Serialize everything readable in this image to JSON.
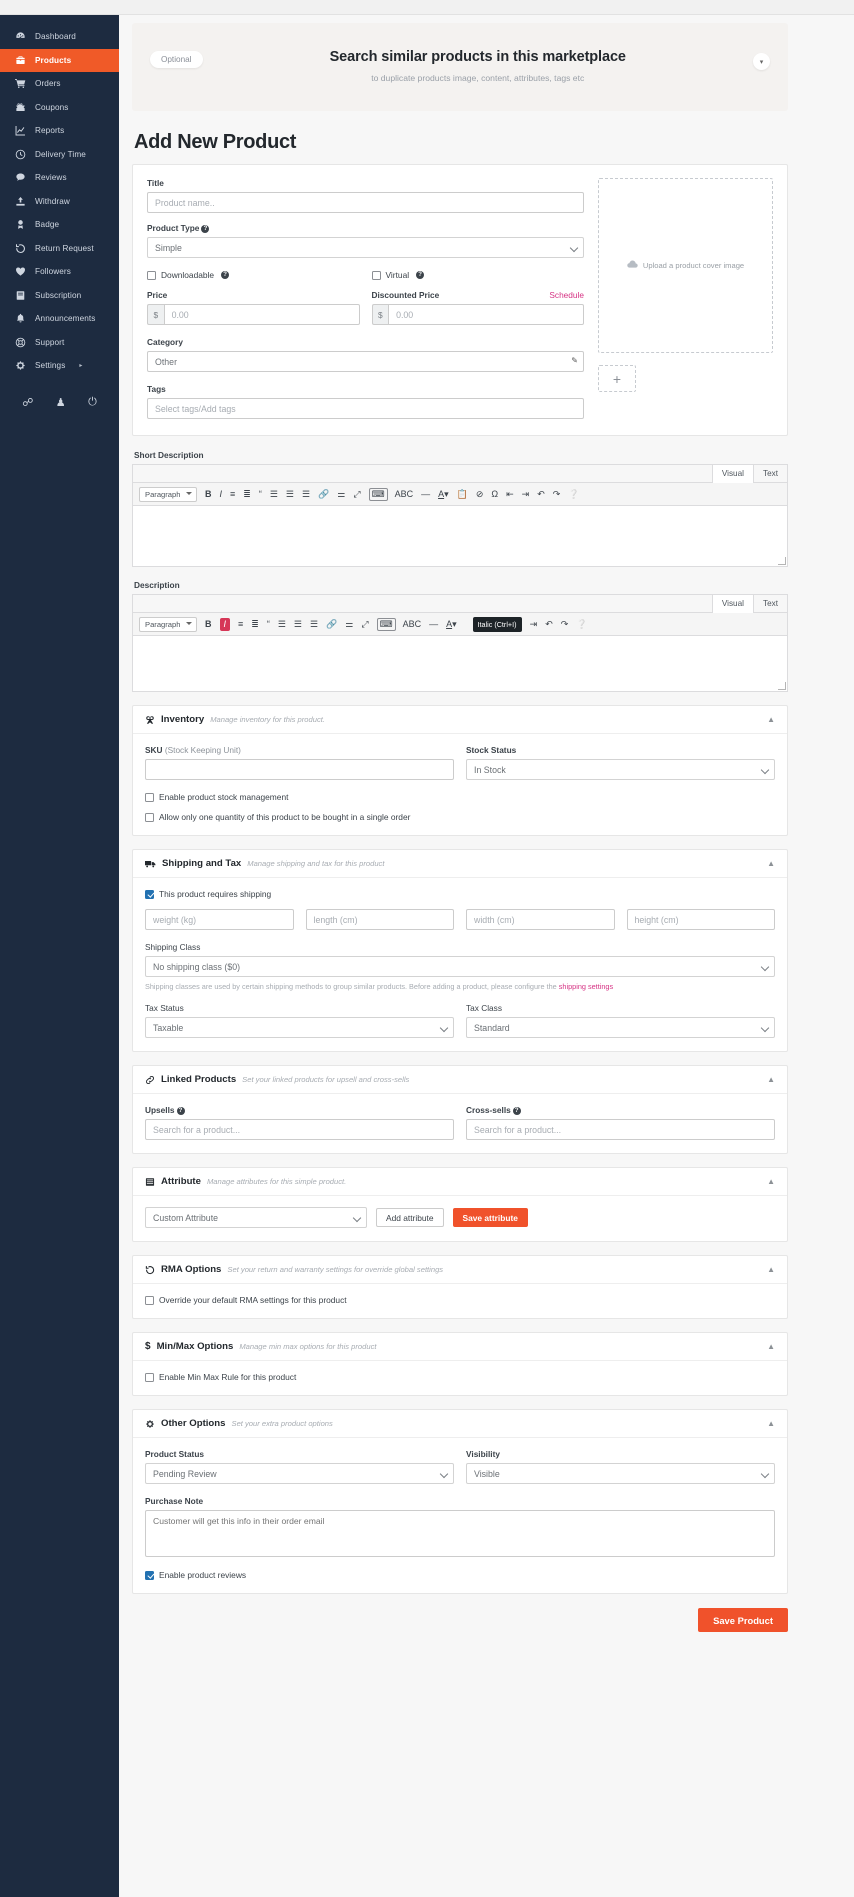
{
  "sidebar": {
    "items": [
      {
        "label": "Dashboard",
        "icon": "dashboard-icon",
        "active": false
      },
      {
        "label": "Products",
        "icon": "products-icon",
        "active": true
      },
      {
        "label": "Orders",
        "icon": "cart-icon",
        "active": false
      },
      {
        "label": "Coupons",
        "icon": "coupon-icon",
        "active": false
      },
      {
        "label": "Reports",
        "icon": "chart-icon",
        "active": false
      },
      {
        "label": "Delivery Time",
        "icon": "clock-icon",
        "active": false
      },
      {
        "label": "Reviews",
        "icon": "comment-icon",
        "active": false
      },
      {
        "label": "Withdraw",
        "icon": "upload-icon",
        "active": false
      },
      {
        "label": "Badge",
        "icon": "badge-icon",
        "active": false
      },
      {
        "label": "Return Request",
        "icon": "return-icon",
        "active": false
      },
      {
        "label": "Followers",
        "icon": "heart-icon",
        "active": false
      },
      {
        "label": "Subscription",
        "icon": "book-icon",
        "active": false
      },
      {
        "label": "Announcements",
        "icon": "bell-icon",
        "active": false
      },
      {
        "label": "Support",
        "icon": "lifering-icon",
        "active": false
      },
      {
        "label": "Settings",
        "icon": "gear-icon",
        "active": false,
        "caret": "▸"
      }
    ],
    "footer_icons": [
      "external-link-icon",
      "user-icon",
      "power-icon"
    ]
  },
  "banner": {
    "pill": "Optional",
    "title": "Search similar products in this marketplace",
    "subtitle": "to duplicate products image, content, attributes, tags etc",
    "caret": "▾"
  },
  "page_title": "Add New Product",
  "basic": {
    "title_label": "Title",
    "title_placeholder": "Product name..",
    "product_type_label": "Product Type",
    "product_type_value": "Simple",
    "downloadable_label": "Downloadable",
    "virtual_label": "Virtual",
    "price_label": "Price",
    "price_prefix": "$",
    "price_placeholder": "0.00",
    "discounted_label": "Discounted Price",
    "discounted_placeholder": "0.00",
    "schedule_label": "Schedule",
    "category_label": "Category",
    "category_value": "Other",
    "tags_label": "Tags",
    "tags_placeholder": "Select tags/Add tags",
    "upload_text": "Upload a product cover image",
    "plus": "+"
  },
  "editors": {
    "short_description_label": "Short Description",
    "description_label": "Description",
    "tab_visual": "Visual",
    "tab_text": "Text",
    "paragraph": "Paragraph",
    "tooltip": "Italic (Ctrl+I)"
  },
  "inventory": {
    "title": "Inventory",
    "desc": "Manage inventory for this product.",
    "sku_label": "SKU",
    "sku_label_light": "(Stock Keeping Unit)",
    "sku_value": "",
    "stock_status_label": "Stock Status",
    "stock_status_value": "In Stock",
    "cb_stock_mgmt": "Enable product stock management",
    "cb_single_qty": "Allow only one quantity of this product to be bought in a single order"
  },
  "shipping": {
    "title": "Shipping and Tax",
    "desc": "Manage shipping and tax for this product",
    "cb_requires_shipping": "This product requires shipping",
    "weight_placeholder": "weight (kg)",
    "length_placeholder": "length (cm)",
    "width_placeholder": "width (cm)",
    "height_placeholder": "height (cm)",
    "shipping_class_label": "Shipping Class",
    "shipping_class_value": "No shipping class ($0)",
    "help_pre": "Shipping classes are used by certain shipping methods to group similar products. Before adding a product, please configure the ",
    "help_link": "shipping settings",
    "tax_status_label": "Tax Status",
    "tax_status_value": "Taxable",
    "tax_class_label": "Tax Class",
    "tax_class_value": "Standard"
  },
  "linked": {
    "title": "Linked Products",
    "desc": "Set your linked products for upsell and cross-sells",
    "upsells_label": "Upsells",
    "upsells_placeholder": "Search for a product...",
    "crosssells_label": "Cross-sells",
    "crosssells_placeholder": "Search for a product..."
  },
  "attribute": {
    "title": "Attribute",
    "desc": "Manage attributes for this simple product.",
    "select_value": "Custom Attribute",
    "add_button": "Add attribute",
    "save_button": "Save attribute"
  },
  "rma": {
    "title": "RMA Options",
    "desc": "Set your return and warranty settings for override global settings",
    "cb_override": "Override your default RMA settings for this product"
  },
  "minmax": {
    "title": "Min/Max Options",
    "desc": "Manage min max options for this product",
    "cb_enable": "Enable Min Max Rule for this product"
  },
  "other": {
    "title": "Other Options",
    "desc": "Set your extra product options",
    "product_status_label": "Product Status",
    "product_status_value": "Pending Review",
    "visibility_label": "Visibility",
    "visibility_value": "Visible",
    "purchase_note_label": "Purchase Note",
    "purchase_note_placeholder": "Customer will get this info in their order email",
    "cb_reviews": "Enable product reviews"
  },
  "footer": {
    "save_label": "Save Product"
  },
  "colors": {
    "accent": "#f05a28",
    "sidebar": "#1d2b40",
    "link": "#d63384",
    "checked": "#2271b1"
  }
}
